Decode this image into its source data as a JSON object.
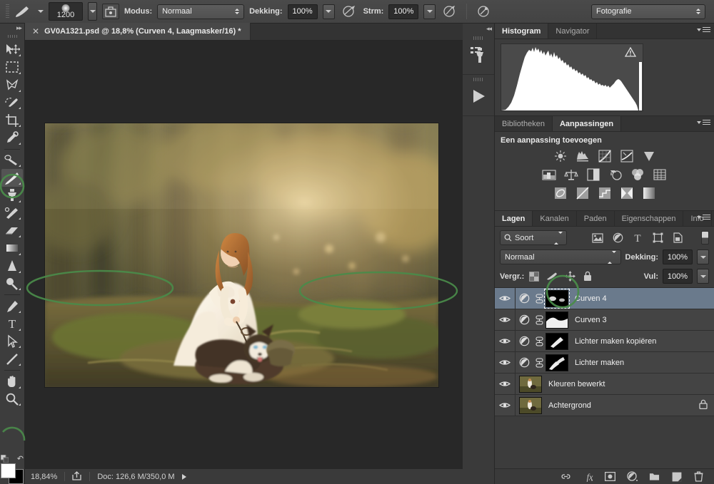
{
  "app": {
    "workspace": "Fotografie",
    "document_tab": "GV0A1321.psd @ 18,8% (Curven 4, Laagmasker/16) *"
  },
  "options_bar": {
    "brush_size": "1200",
    "mode_label": "Modus:",
    "mode_value": "Normaal",
    "opacity_label": "Dekking:",
    "opacity_value": "100%",
    "flow_label": "Strm:",
    "flow_value": "100%",
    "icons": [
      "brush-preset-icon",
      "brush-panel-icon",
      "airbrush-icon",
      "symmetry-icon",
      "tablet-pressure-icon"
    ]
  },
  "toolbar": {
    "tools": [
      {
        "name": "move-tool",
        "glyph": "move"
      },
      {
        "name": "rectangular-marquee-tool",
        "glyph": "marquee"
      },
      {
        "name": "lasso-tool",
        "glyph": "lasso"
      },
      {
        "name": "quick-selection-tool",
        "glyph": "quickselect"
      },
      {
        "name": "crop-tool",
        "glyph": "crop"
      },
      {
        "name": "eyedropper-tool",
        "glyph": "eyedropper"
      },
      {
        "name": "healing-brush-tool",
        "glyph": "heal"
      },
      {
        "name": "brush-tool",
        "glyph": "brush",
        "selected": true
      },
      {
        "name": "clone-stamp-tool",
        "glyph": "stamp"
      },
      {
        "name": "history-brush-tool",
        "glyph": "historybrush"
      },
      {
        "name": "eraser-tool",
        "glyph": "eraser"
      },
      {
        "name": "gradient-tool",
        "glyph": "gradient"
      },
      {
        "name": "blur-tool",
        "glyph": "blur"
      },
      {
        "name": "dodge-tool",
        "glyph": "dodge"
      },
      {
        "name": "pen-tool",
        "glyph": "pen"
      },
      {
        "name": "type-tool",
        "glyph": "type"
      },
      {
        "name": "path-selection-tool",
        "glyph": "pathselect"
      },
      {
        "name": "line-tool",
        "glyph": "line"
      },
      {
        "name": "hand-tool",
        "glyph": "hand"
      },
      {
        "name": "zoom-tool",
        "glyph": "zoom"
      }
    ],
    "foreground_color": "#ffffff",
    "background_color": "#000000"
  },
  "status_bar": {
    "zoom": "18,84%",
    "doc_info": "Doc: 126,6 M/350,0 M"
  },
  "histogram_panel": {
    "tabs": [
      {
        "label": "Histogram",
        "active": true
      },
      {
        "label": "Navigator",
        "active": false
      }
    ],
    "warning_icon": "uncached-data-warning-icon"
  },
  "adjustments_panel": {
    "tabs": [
      {
        "label": "Bibliotheken",
        "active": false
      },
      {
        "label": "Aanpassingen",
        "active": true
      }
    ],
    "title": "Een aanpassing toevoegen",
    "rows": [
      [
        "brightness-contrast-icon",
        "levels-icon",
        "curves-icon",
        "exposure-icon",
        "vibrance-icon"
      ],
      [
        "hue-saturation-icon",
        "color-balance-icon",
        "black-white-icon",
        "photo-filter-icon",
        "channel-mixer-icon",
        "color-lookup-icon"
      ],
      [
        "invert-icon",
        "posterize-icon",
        "threshold-icon",
        "selective-color-icon",
        "gradient-map-icon"
      ]
    ]
  },
  "layers_panel": {
    "tabs": [
      {
        "label": "Lagen",
        "active": true
      },
      {
        "label": "Kanalen",
        "active": false
      },
      {
        "label": "Paden",
        "active": false
      },
      {
        "label": "Eigenschappen",
        "active": false
      },
      {
        "label": "Info",
        "active": false
      }
    ],
    "filter_value": "Soort",
    "filter_icons": [
      "filter-pixel-icon",
      "filter-adjustment-icon",
      "filter-type-icon",
      "filter-shape-icon",
      "filter-smartobject-icon"
    ],
    "blend_mode": "Normaal",
    "opacity_label": "Dekking:",
    "opacity_value": "100%",
    "lock_label": "Vergr.:",
    "lock_icons": [
      "lock-transparency-icon",
      "lock-image-icon",
      "lock-position-icon",
      "lock-all-icon"
    ],
    "fill_label": "Vul:",
    "fill_value": "100%",
    "layers": [
      {
        "name": "Curven 4",
        "type": "adjustment",
        "selected": true,
        "visible": true,
        "linked": true,
        "mask": "curven4-mask",
        "highlighted_mask": true
      },
      {
        "name": "Curven 3",
        "type": "adjustment",
        "selected": false,
        "visible": true,
        "linked": true,
        "mask": "curven3-mask"
      },
      {
        "name": "Lichter maken kopiëren",
        "type": "adjustment",
        "selected": false,
        "visible": true,
        "linked": true,
        "mask": "lichter-kopieren-mask"
      },
      {
        "name": "Lichter maken",
        "type": "adjustment",
        "selected": false,
        "visible": true,
        "linked": true,
        "mask": "lichter-maken-mask"
      },
      {
        "name": "Kleuren bewerkt",
        "type": "pixel",
        "selected": false,
        "visible": true
      },
      {
        "name": "Achtergrond",
        "type": "pixel",
        "selected": false,
        "visible": true,
        "locked": true
      }
    ],
    "footer_icons": [
      "link-layers-icon",
      "layer-style-icon",
      "add-mask-icon",
      "new-adjustment-icon",
      "new-group-icon",
      "new-layer-icon",
      "delete-layer-icon"
    ]
  },
  "mini_dock": {
    "items": [
      "clone-source-panel-icon",
      "actions-panel-icon"
    ]
  },
  "annotations": {
    "color": "#3f7a3f",
    "shapes": [
      "brush-tool-circle",
      "canvas-left-ellipse",
      "canvas-right-ellipse",
      "mask-thumbnail-circle",
      "color-swatch-circle"
    ]
  }
}
